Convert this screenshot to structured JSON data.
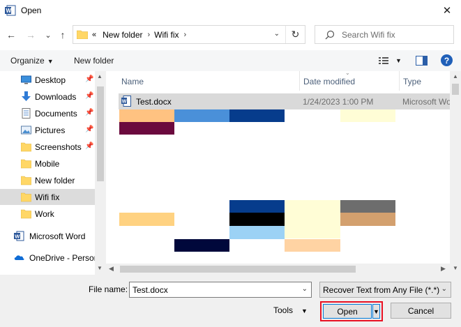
{
  "window": {
    "title": "Open",
    "close_glyph": "✕"
  },
  "nav": {
    "back_icon": "←",
    "forward_icon": "→",
    "recent_icon": "⌄",
    "up_icon": "↑",
    "breadcrumb": {
      "overflow": "«",
      "items": [
        "New folder",
        "Wifi fix"
      ],
      "sep": "›"
    },
    "refresh_icon": "↻",
    "search": {
      "placeholder": "Search Wifi fix"
    }
  },
  "toolbar": {
    "organize_label": "Organize",
    "new_folder_label": "New folder",
    "help_glyph": "?"
  },
  "sidebar": {
    "items": [
      {
        "label": "Desktop",
        "icon": "desktop-icon",
        "pinned": true
      },
      {
        "label": "Downloads",
        "icon": "download-icon",
        "pinned": true
      },
      {
        "label": "Documents",
        "icon": "documents-icon",
        "pinned": true
      },
      {
        "label": "Pictures",
        "icon": "pictures-icon",
        "pinned": true
      },
      {
        "label": "Screenshots",
        "icon": "folder-icon",
        "pinned": true
      },
      {
        "label": "Mobile",
        "icon": "folder-icon",
        "pinned": false
      },
      {
        "label": "New folder",
        "icon": "folder-icon",
        "pinned": false
      },
      {
        "label": "Wifi fix",
        "icon": "folder-icon",
        "pinned": false,
        "selected": true
      },
      {
        "label": "Work",
        "icon": "folder-icon",
        "pinned": false
      },
      {
        "label": "Microsoft Word",
        "icon": "word-icon",
        "root": true
      },
      {
        "label": "OneDrive - Persor",
        "icon": "onedrive-icon",
        "root": true
      }
    ]
  },
  "content": {
    "columns": {
      "name": "Name",
      "date": "Date modified",
      "type": "Type"
    },
    "files": [
      {
        "name": "Test.docx",
        "date": "1/24/2023 1:00 PM",
        "type": "Microsoft Wo"
      }
    ]
  },
  "bottom": {
    "file_name_label": "File name:",
    "file_name_value": "Test.docx",
    "filter_value": "Recover Text from Any File (*.*)",
    "tools_label": "Tools",
    "open_label": "Open",
    "cancel_label": "Cancel"
  },
  "colors": {
    "block_peach": "#ffc281",
    "block_light_blue": "#4a90d9",
    "block_navy": "#063c8c",
    "block_cream": "#fffdd6",
    "block_maroon": "#6b0a3e",
    "block_gray": "#6d6d6d",
    "block_tan": "#d3a06e",
    "block_black": "#000000",
    "block_sky": "#9cd2f5",
    "block_midnight": "#00083b",
    "block_light_peach": "#ffd3a3",
    "block_pale_orange": "#ffd281"
  }
}
